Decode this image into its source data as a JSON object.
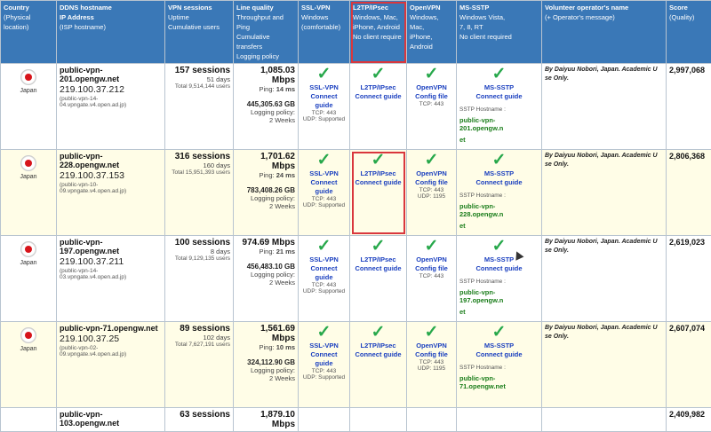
{
  "headers": {
    "country": {
      "title": "Country",
      "sub": "(Physical location)"
    },
    "ddns": {
      "title": "DDNS hostname",
      "sub1": "IP Address",
      "sub2": "(ISP hostname)"
    },
    "sessions": {
      "title": "VPN sessions",
      "sub1": "Uptime",
      "sub2": "Cumulative users"
    },
    "quality": {
      "title": "Line quality",
      "sub1": "Throughput and Ping",
      "sub2": "Cumulative transfers",
      "sub3": "Logging policy"
    },
    "sslvpn": {
      "title": "SSL-VPN",
      "sub1": "Windows",
      "sub2": "(comfortable)"
    },
    "l2tp": {
      "title": "L2TP/IPsec",
      "sub1": "Windows, Mac,",
      "sub2": "iPhone, Android",
      "sub3": "No client require"
    },
    "openvpn": {
      "title": "OpenVPN",
      "sub1": "Windows, Mac,",
      "sub2": "iPhone, Android"
    },
    "mssstp": {
      "title": "MS-SSTP",
      "sub1": "Windows Vista,",
      "sub2": "7, 8, RT",
      "sub3": "No client required"
    },
    "operator": {
      "title": "Volunteer operator's name",
      "sub": "(+ Operator's message)"
    },
    "score": {
      "title": "Score",
      "sub": "(Quality)"
    }
  },
  "labels": {
    "check": "✓",
    "connect_guide": "Connect guide",
    "config_file": "Config file",
    "sslvpn": "SSL-VPN",
    "l2tp": "L2TP/IPsec",
    "openvpn": "OpenVPN",
    "mssstp": "MS-SSTP",
    "sstp_hostname": "SSTP Hostname :",
    "logging_policy": "Logging policy:"
  },
  "rows": [
    {
      "country": "Japan",
      "host": "public-vpn-201.opengw.net",
      "ip": "219.100.37.212",
      "isp": "(public-vpn-14-04.vpngate.v4.open.ad.jp)",
      "sessions": "157 sessions",
      "uptime": "51 days",
      "users": "Total 9,514,144 users",
      "speed": "1,085.03 Mbps",
      "ping_label": "Ping:",
      "ping": "14 ms",
      "transfer": "445,305.63 GB",
      "policy": "2 Weeks",
      "ssl_tcp": "TCP: 443",
      "ssl_udp": "UDP: Supported",
      "ovpn_tcp": "TCP: 443",
      "ovpn_udp": "",
      "sstp_host": "public-vpn-201.opengw.n",
      "sstp_host2": "et",
      "operator": "By Daiyuu Nobori, Japan. Academic U",
      "operator2": "se Only.",
      "score": "2,997,068"
    },
    {
      "country": "Japan",
      "host": "public-vpn-228.opengw.net",
      "ip": "219.100.37.153",
      "isp": "(public-vpn-10-09.vpngate.v4.open.ad.jp)",
      "sessions": "316 sessions",
      "uptime": "160 days",
      "users": "Total 15,951,393 users",
      "speed": "1,701.62 Mbps",
      "ping_label": "Ping:",
      "ping": "24 ms",
      "transfer": "783,408.26 GB",
      "policy": "2 Weeks",
      "ssl_tcp": "TCP: 443",
      "ssl_udp": "UDP: Supported",
      "ovpn_tcp": "TCP: 443",
      "ovpn_udp": "UDP: 1195",
      "sstp_host": "public-vpn-228.opengw.n",
      "sstp_host2": "et",
      "operator": "By Daiyuu Nobori, Japan. Academic U",
      "operator2": "se Only.",
      "score": "2,806,368"
    },
    {
      "country": "Japan",
      "host": "public-vpn-197.opengw.net",
      "ip": "219.100.37.211",
      "isp": "(public-vpn-14-03.vpngate.v4.open.ad.jp)",
      "sessions": "100 sessions",
      "uptime": "8 days",
      "users": "Total 9,129,135 users",
      "speed": "974.69 Mbps",
      "ping_label": "Ping:",
      "ping": "21 ms",
      "transfer": "456,483.10 GB",
      "policy": "2 Weeks",
      "ssl_tcp": "TCP: 443",
      "ssl_udp": "UDP: Supported",
      "ovpn_tcp": "TCP: 443",
      "ovpn_udp": "",
      "sstp_host": "public-vpn-197.opengw.n",
      "sstp_host2": "et",
      "operator": "By Daiyuu Nobori, Japan. Academic U",
      "operator2": "se Only.",
      "score": "2,619,023"
    },
    {
      "country": "Japan",
      "host": "public-vpn-71.opengw.net",
      "ip": "219.100.37.25",
      "isp": "(public-vpn-02-09.vpngate.v4.open.ad.jp)",
      "sessions": "89 sessions",
      "uptime": "102 days",
      "users": "Total 7,627,191 users",
      "speed": "1,561.69 Mbps",
      "ping_label": "Ping:",
      "ping": "10 ms",
      "transfer": "324,112.90 GB",
      "policy": "2 Weeks",
      "ssl_tcp": "TCP: 443",
      "ssl_udp": "UDP: Supported",
      "ovpn_tcp": "TCP: 443",
      "ovpn_udp": "UDP: 1195",
      "sstp_host": "public-vpn-71.opengw.net",
      "sstp_host2": "",
      "operator": "By Daiyuu Nobori, Japan. Academic U",
      "operator2": "se Only.",
      "score": "2,607,074"
    }
  ],
  "partial_row": {
    "host": "public-vpn-103.opengw.net",
    "sessions": "63 sessions",
    "speed": "1,879.10 Mbps",
    "score": "2,409,982"
  }
}
